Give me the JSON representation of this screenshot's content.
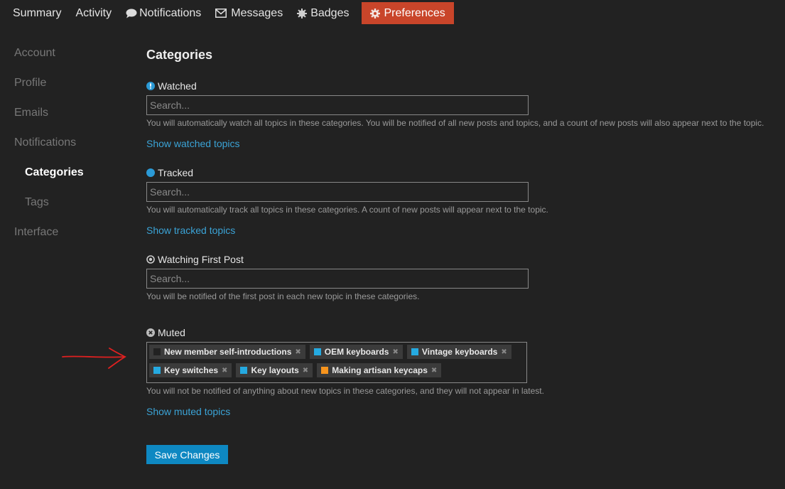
{
  "topnav": {
    "items": [
      {
        "label": "Summary",
        "icon": ""
      },
      {
        "label": "Activity",
        "icon": ""
      },
      {
        "label": "Notifications",
        "icon": "comment-icon"
      },
      {
        "label": "Messages",
        "icon": "envelope-icon"
      },
      {
        "label": "Badges",
        "icon": "badge-icon"
      },
      {
        "label": "Preferences",
        "icon": "gear-icon"
      }
    ],
    "active_color": "#c9452a"
  },
  "sidebar": {
    "items": [
      {
        "label": "Account"
      },
      {
        "label": "Profile"
      },
      {
        "label": "Emails"
      },
      {
        "label": "Notifications"
      },
      {
        "label": "Categories"
      },
      {
        "label": "Tags"
      },
      {
        "label": "Interface"
      }
    ]
  },
  "main": {
    "title": "Categories",
    "watched": {
      "label": "Watched",
      "icon": "exclamation-circle-icon",
      "placeholder": "Search...",
      "help": "You will automatically watch all topics in these categories. You will be notified of all new posts and topics, and a count of new posts will also appear next to the topic.",
      "link": "Show watched topics"
    },
    "tracked": {
      "label": "Tracked",
      "icon": "circle-icon",
      "placeholder": "Search...",
      "help": "You will automatically track all topics in these categories. A count of new posts will appear next to the topic.",
      "link": "Show tracked topics"
    },
    "watching_first": {
      "label": "Watching First Post",
      "icon": "dot-circle-icon",
      "placeholder": "Search...",
      "help": "You will be notified of the first post in each new topic in these categories."
    },
    "muted": {
      "label": "Muted",
      "icon": "times-circle-icon",
      "tags": [
        {
          "label": "New member self-introductions",
          "color": "#222222"
        },
        {
          "label": "OEM keyboards",
          "color": "#25aae1"
        },
        {
          "label": "Vintage keyboards",
          "color": "#25aae1"
        },
        {
          "label": "Key switches",
          "color": "#25aae1"
        },
        {
          "label": "Key layouts",
          "color": "#25aae1"
        },
        {
          "label": "Making artisan keycaps",
          "color": "#f7941d"
        }
      ],
      "help": "You will not be notified of anything about new topics in these categories, and they will not appear in latest.",
      "link": "Show muted topics"
    },
    "save_label": "Save Changes"
  },
  "colors": {
    "background": "#222222",
    "link": "#3ba3d6",
    "button": "#0e88c2",
    "annotation_arrow": "#e02020"
  }
}
